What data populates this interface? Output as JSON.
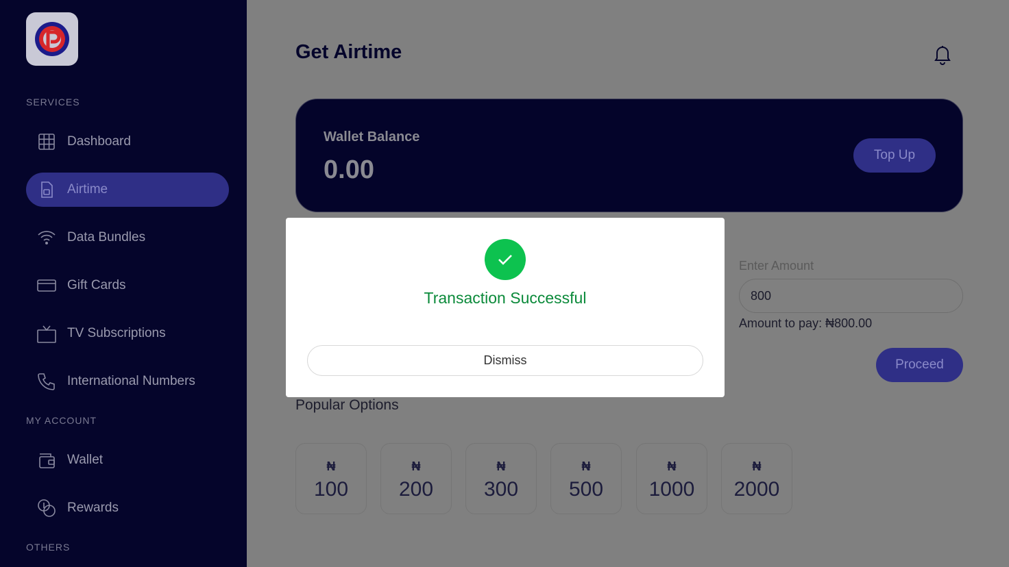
{
  "sidebar": {
    "sections": {
      "services": "SERVICES",
      "my_account": "MY ACCOUNT",
      "others": "OTHERS"
    },
    "items": [
      {
        "label": "Dashboard",
        "icon": "grid-icon"
      },
      {
        "label": "Airtime",
        "icon": "sim-card-icon",
        "active": true
      },
      {
        "label": "Data Bundles",
        "icon": "wifi-icon"
      },
      {
        "label": "Gift Cards",
        "icon": "card-icon"
      },
      {
        "label": "TV Subscriptions",
        "icon": "tv-icon"
      },
      {
        "label": "International Numbers",
        "icon": "phone-icon"
      },
      {
        "label": "Wallet",
        "icon": "wallet-icon"
      },
      {
        "label": "Rewards",
        "icon": "coins-icon"
      }
    ]
  },
  "header": {
    "title": "Get Airtime",
    "icon": "bell-icon"
  },
  "wallet": {
    "label": "Wallet Balance",
    "balance": "0.00",
    "topup_label": "Top Up"
  },
  "form": {
    "amount_label": "Enter Amount",
    "amount_value": "800",
    "amount_to_pay": "Amount to pay: ₦800.00",
    "proceed_label": "Proceed"
  },
  "popular": {
    "title": "Popular Options",
    "currency": "₦",
    "options": [
      "100",
      "200",
      "300",
      "500",
      "1000",
      "2000"
    ]
  },
  "modal": {
    "title": "Transaction Successful",
    "dismiss_label": "Dismiss",
    "icon": "check-icon"
  },
  "colors": {
    "sidebar_bg": "#05052b",
    "accent": "#2f2f86",
    "success": "#0dc24f",
    "overlay": "#808080"
  }
}
